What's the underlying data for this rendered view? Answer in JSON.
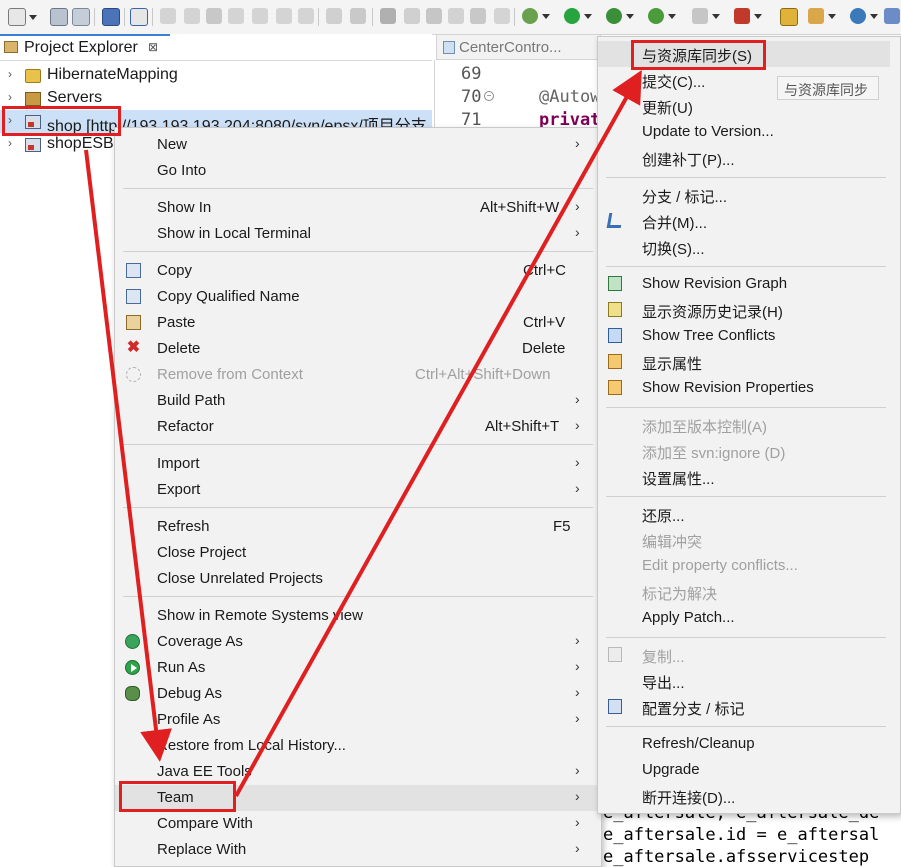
{
  "left_view": {
    "tab_label": "Project Explorer",
    "tab_close": "⊠",
    "tree": [
      {
        "label": "HibernateMapping"
      },
      {
        "label": "Servers"
      },
      {
        "label": "shop [http://193.193.193.204:8080/svn/epsx/项目分支"
      },
      {
        "label": "shopESB"
      }
    ]
  },
  "editor": {
    "tab_label": "CenterContro...",
    "line_numbers": [
      "69",
      "70",
      "71"
    ],
    "code_lines": [
      "@Autow",
      "privat"
    ]
  },
  "context_menu": {
    "items": [
      {
        "label": "New",
        "shortcut": "",
        "submenu": true
      },
      {
        "label": "Go Into",
        "shortcut": "",
        "submenu": false
      },
      {
        "label": "Show In",
        "shortcut": "Alt+Shift+W",
        "submenu": true
      },
      {
        "label": "Show in Local Terminal",
        "shortcut": "",
        "submenu": true
      },
      {
        "label": "Copy",
        "shortcut": "Ctrl+C",
        "submenu": false,
        "icon": "copy-icon"
      },
      {
        "label": "Copy Qualified Name",
        "shortcut": "",
        "submenu": false,
        "icon": "copy-qualified-icon"
      },
      {
        "label": "Paste",
        "shortcut": "Ctrl+V",
        "submenu": false,
        "icon": "paste-icon"
      },
      {
        "label": "Delete",
        "shortcut": "Delete",
        "submenu": false,
        "icon": "delete-icon"
      },
      {
        "label": "Remove from Context",
        "shortcut": "Ctrl+Alt+Shift+Down",
        "submenu": false,
        "disabled": true,
        "icon": "remove-context-icon"
      },
      {
        "label": "Build Path",
        "shortcut": "",
        "submenu": true
      },
      {
        "label": "Refactor",
        "shortcut": "Alt+Shift+T",
        "submenu": true
      },
      {
        "label": "Import",
        "shortcut": "",
        "submenu": true
      },
      {
        "label": "Export",
        "shortcut": "",
        "submenu": true
      },
      {
        "label": "Refresh",
        "shortcut": "F5",
        "submenu": false
      },
      {
        "label": "Close Project",
        "shortcut": "",
        "submenu": false
      },
      {
        "label": "Close Unrelated Projects",
        "shortcut": "",
        "submenu": false
      },
      {
        "label": "Show in Remote Systems view",
        "shortcut": "",
        "submenu": false
      },
      {
        "label": "Coverage As",
        "shortcut": "",
        "submenu": true,
        "icon": "coverage-icon"
      },
      {
        "label": "Run As",
        "shortcut": "",
        "submenu": true,
        "icon": "run-icon"
      },
      {
        "label": "Debug As",
        "shortcut": "",
        "submenu": true,
        "icon": "debug-icon"
      },
      {
        "label": "Profile As",
        "shortcut": "",
        "submenu": true
      },
      {
        "label": "Restore from Local History...",
        "shortcut": "",
        "submenu": false
      },
      {
        "label": "Java EE Tools",
        "shortcut": "",
        "submenu": true
      },
      {
        "label": "Team",
        "shortcut": "",
        "submenu": true,
        "highlighted": true
      },
      {
        "label": "Compare With",
        "shortcut": "",
        "submenu": true
      },
      {
        "label": "Replace With",
        "shortcut": "",
        "submenu": true
      }
    ]
  },
  "team_submenu": {
    "items": [
      {
        "label": "与资源库同步(S)",
        "highlighted": true
      },
      {
        "label": "提交(C)..."
      },
      {
        "label": "更新(U)"
      },
      {
        "label": "Update to Version..."
      },
      {
        "label": "创建补丁(P)..."
      },
      {
        "label": "分支 / 标记..."
      },
      {
        "label": "合并(M)...",
        "icon": "merge-icon"
      },
      {
        "label": "切换(S)..."
      },
      {
        "label": "Show Revision Graph",
        "icon": "revision-graph-icon"
      },
      {
        "label": "显示资源历史记录(H)",
        "icon": "history-icon"
      },
      {
        "label": "Show Tree Conflicts",
        "icon": "tree-conflicts-icon"
      },
      {
        "label": "显示属性",
        "icon": "properties-icon"
      },
      {
        "label": "Show Revision Properties",
        "icon": "revision-properties-icon"
      },
      {
        "label": "添加至版本控制(A)",
        "disabled": true
      },
      {
        "label": "添加至 svn:ignore (D)",
        "disabled": true
      },
      {
        "label": "设置属性..."
      },
      {
        "label": "还原..."
      },
      {
        "label": "编辑冲突",
        "disabled": true
      },
      {
        "label": "Edit property conflicts...",
        "disabled": true
      },
      {
        "label": "标记为解决",
        "disabled": true
      },
      {
        "label": "Apply Patch..."
      },
      {
        "label": "复制...",
        "disabled": true,
        "icon": "copy-icon"
      },
      {
        "label": "导出..."
      },
      {
        "label": "配置分支 / 标记",
        "icon": "configure-branch-icon"
      },
      {
        "label": "Refresh/Cleanup"
      },
      {
        "label": "Upgrade"
      },
      {
        "label": "断开连接(D)..."
      }
    ],
    "tooltip": "与资源库同步"
  },
  "bottom_code": [
    "e_aftersale, e_aftersale_de",
    "e_aftersale.id = e_aftersal",
    "e_aftersale.afsservicestep"
  ],
  "colors": {
    "annotation_red": "#e02020",
    "selection_blue": "#cce0f7",
    "menu_bg": "#f2f2f2"
  }
}
